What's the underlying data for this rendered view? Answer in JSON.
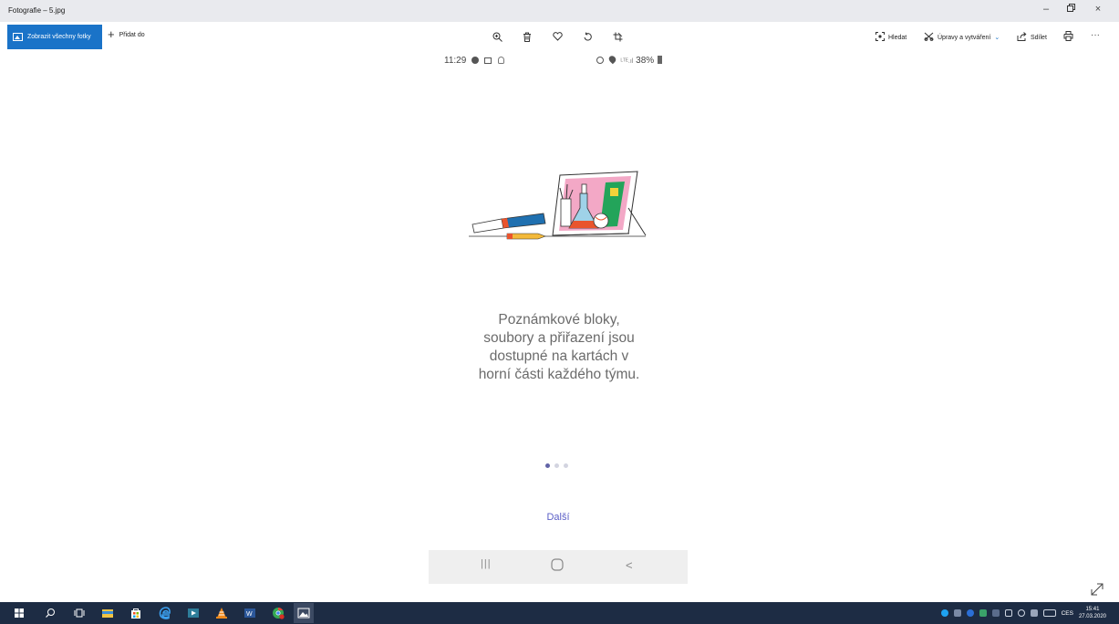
{
  "window": {
    "title": "Fotografie – 5.jpg",
    "controls": {
      "minimize": "–",
      "maximize": "▫",
      "close": "×"
    }
  },
  "toolbar": {
    "view_all_label": "Zobrazit všechny fotky",
    "add_to_label": "Přidat do",
    "center_icons": [
      "zoom-icon",
      "trash-icon",
      "heart-icon",
      "rotate-icon",
      "crop-icon"
    ],
    "search_label": "Hledat",
    "edit_label": "Úpravy a vytváření",
    "share_label": "Sdílet",
    "more_label": "···"
  },
  "phone_status": {
    "time": "11:29",
    "right": "38%"
  },
  "content": {
    "message_lines": [
      "Poznámkové bloky,",
      "soubory a přiřazení jsou",
      "dostupné na kartách v",
      "horní části každého týmu."
    ],
    "page_dots": 3,
    "active_dot": 0,
    "next_label": "Další"
  },
  "android_nav": {
    "recents": "|||",
    "home": "○",
    "back": "<"
  },
  "taskbar": {
    "language": "CES",
    "time": "15:41",
    "date": "27.03.2020",
    "colors": {
      "bg": "#1d2c44",
      "accent": "#1a73c8"
    }
  }
}
